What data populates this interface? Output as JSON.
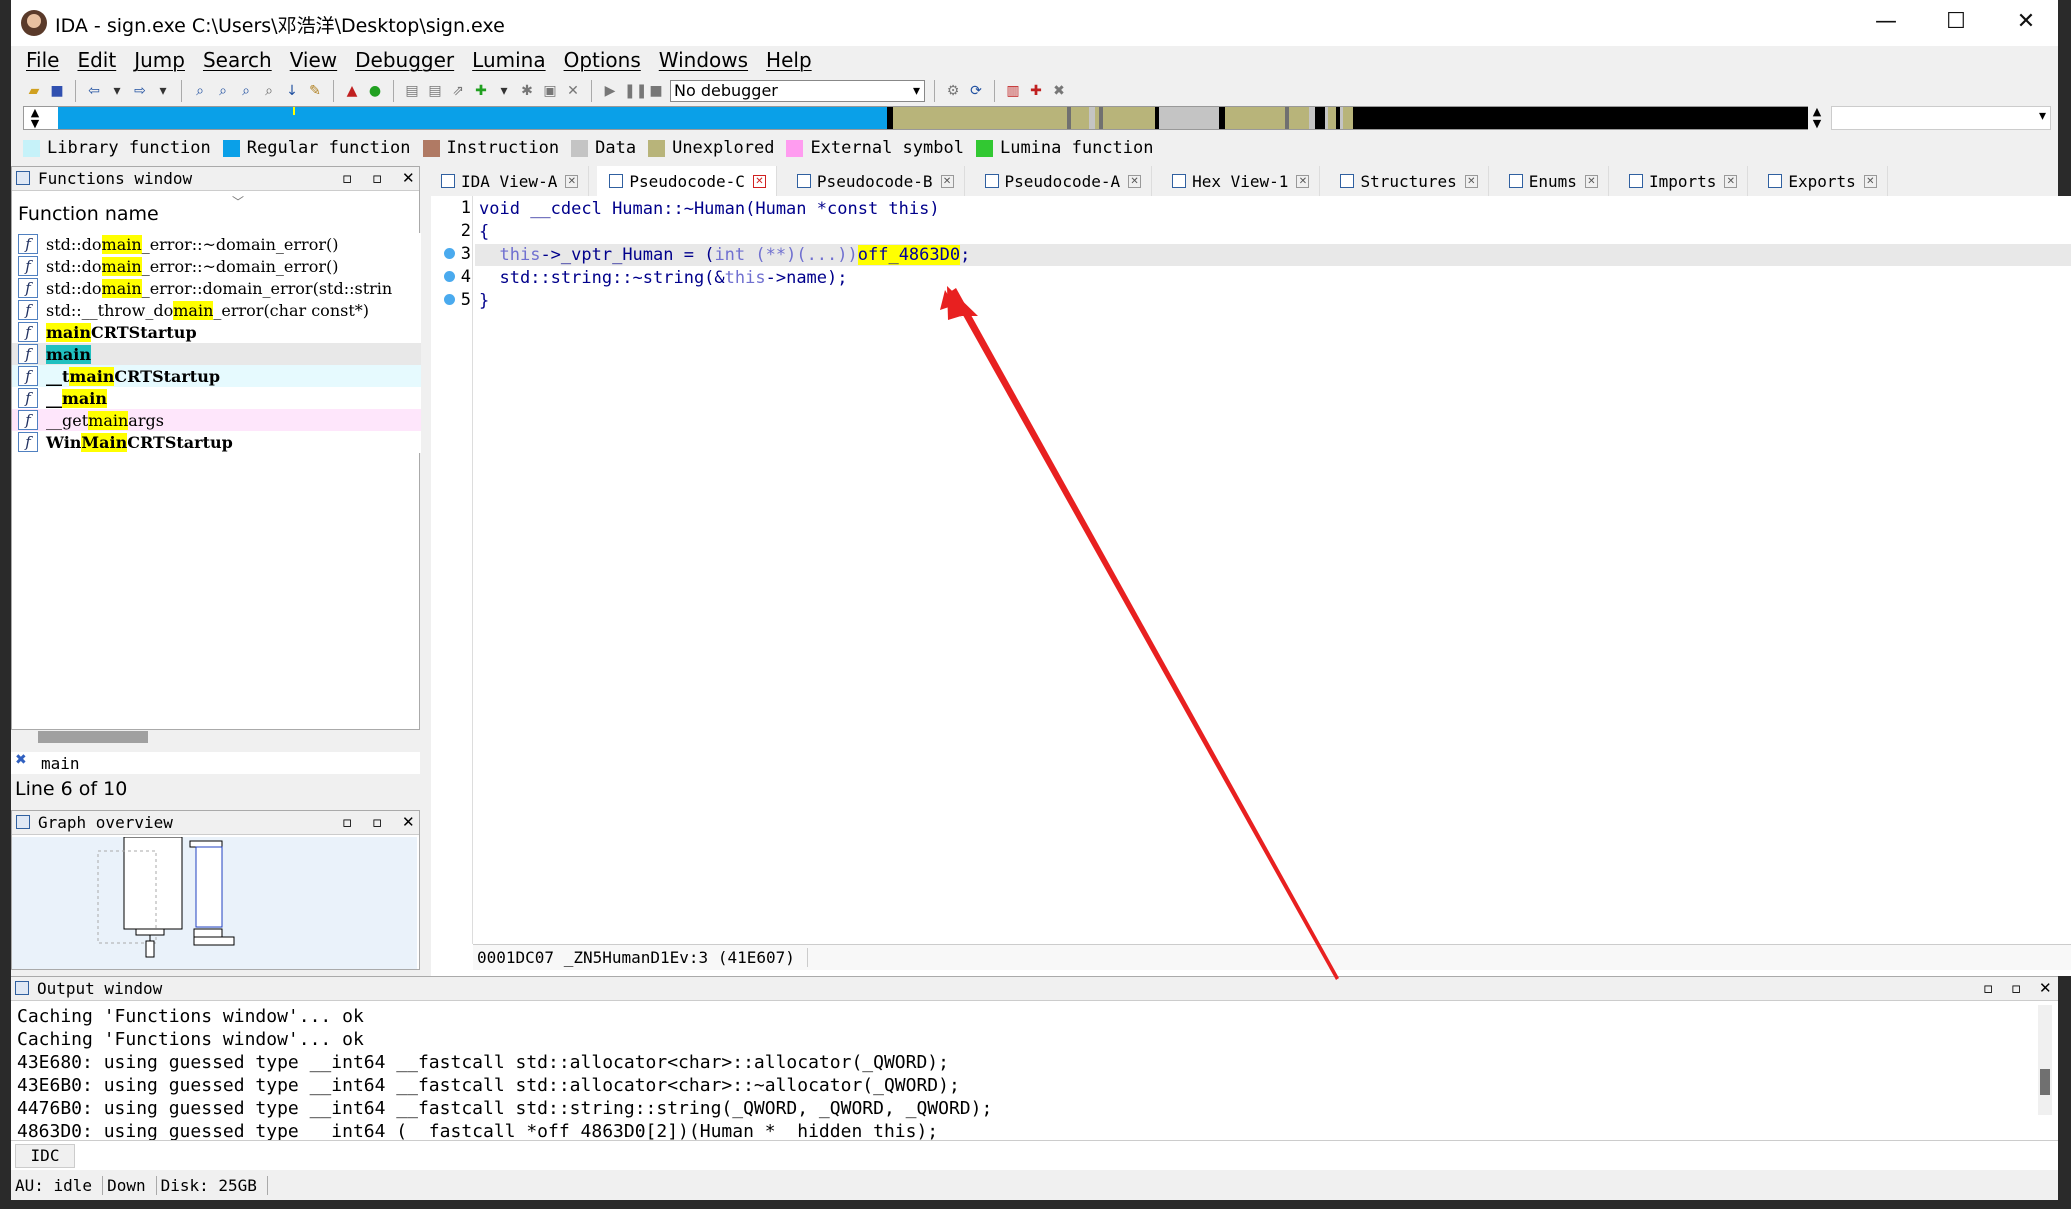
{
  "window": {
    "title": "IDA - sign.exe C:\\Users\\邓浩洋\\Desktop\\sign.exe",
    "minimize": "—",
    "maximize": "☐",
    "close": "✕"
  },
  "menu": [
    "File",
    "Edit",
    "Jump",
    "Search",
    "View",
    "Debugger",
    "Lumina",
    "Options",
    "Windows",
    "Help"
  ],
  "toolbar": {
    "debugger_value": "No debugger"
  },
  "legend": [
    {
      "label": "Library function",
      "color": "#c6f2f9"
    },
    {
      "label": "Regular function",
      "color": "#0aa0e8"
    },
    {
      "label": "Instruction",
      "color": "#b07a64"
    },
    {
      "label": "Data",
      "color": "#c4c4c4"
    },
    {
      "label": "Unexplored",
      "color": "#b8b47a"
    },
    {
      "label": "External symbol",
      "color": "#ff9cf0"
    },
    {
      "label": "Lumina function",
      "color": "#32c832"
    }
  ],
  "functions_window": {
    "title": "Functions window",
    "column": "Function name",
    "items": [
      {
        "pre": "std::do",
        "hl": "main",
        "post": "_error::~domain_error()",
        "bold": false,
        "bg": "#ffffff"
      },
      {
        "pre": "std::do",
        "hl": "main",
        "post": "_error::~domain_error()",
        "bold": false,
        "bg": "#ffffff"
      },
      {
        "pre": "std::do",
        "hl": "main",
        "post": "_error::domain_error(std::strin",
        "bold": false,
        "bg": "#ffffff"
      },
      {
        "pre": "std::__throw_do",
        "hl": "main",
        "post": "_error(char const*)",
        "bold": false,
        "bg": "#ffffff"
      },
      {
        "pre": "",
        "hl": "main",
        "post": "CRTStartup",
        "bold": true,
        "bg": "#ffffff"
      },
      {
        "pre": "",
        "hl": "main",
        "post": "",
        "bold": true,
        "bg": "#e8e8e8"
      },
      {
        "pre": "__t",
        "hl": "main",
        "post": "CRTStartup",
        "bold": true,
        "bg": "#e6fafe"
      },
      {
        "pre": "__",
        "hl": "main",
        "post": "",
        "bold": true,
        "bg": "#ffffff"
      },
      {
        "pre": "__get",
        "hl": "main",
        "post": "args",
        "bold": false,
        "bg": "#fee6fb"
      },
      {
        "pre": "Win",
        "hl": "Main",
        "post": "CRTStartup",
        "bold": true,
        "bg": "#ffffff"
      }
    ],
    "filter_text": "main",
    "status": "Line 6 of 10"
  },
  "graph_overview": {
    "title": "Graph overview"
  },
  "tabs": [
    {
      "label": "IDA View-A",
      "active": false
    },
    {
      "label": "Pseudocode-C",
      "active": true
    },
    {
      "label": "Pseudocode-B",
      "active": false
    },
    {
      "label": "Pseudocode-A",
      "active": false
    },
    {
      "label": "Hex View-1",
      "active": false
    },
    {
      "label": "Structures",
      "active": false
    },
    {
      "label": "Enums",
      "active": false
    },
    {
      "label": "Imports",
      "active": false
    },
    {
      "label": "Exports",
      "active": false
    }
  ],
  "code": {
    "line_numbers": [
      "1",
      "2",
      "3",
      "4",
      "5"
    ],
    "line1": {
      "kw": "void",
      "rest": " __cdecl Human::~Human(Human *const this)"
    },
    "line2": "{",
    "line3": {
      "a": "this",
      "b": "->_vptr_Human = (",
      "c": "int",
      "d": " (**)(...))",
      "e": "off_4863D0",
      ";": ";"
    },
    "line4": {
      "a": "std::string::~string(&",
      "b": "this",
      "c": "->name);"
    },
    "line5": "}",
    "status": "0001DC07 _ZN5HumanD1Ev:3 (41E607)"
  },
  "output": {
    "title": "Output window",
    "lines": [
      "Caching 'Functions window'... ok",
      "Caching 'Functions window'... ok",
      "43E680: using guessed type __int64 __fastcall std::allocator<char>::allocator(_QWORD);",
      "43E6B0: using guessed type __int64 __fastcall std::allocator<char>::~allocator(_QWORD);",
      "4476B0: using guessed type __int64 __fastcall std::string::string(_QWORD, _QWORD, _QWORD);",
      "4863D0: using guessed type __int64 (__fastcall *off_4863D0[2])(Human *__hidden this);"
    ],
    "idc_label": "IDC"
  },
  "statusbar": {
    "au": "AU:  idle",
    "dir": "Down",
    "disk": "Disk: 25GB"
  }
}
